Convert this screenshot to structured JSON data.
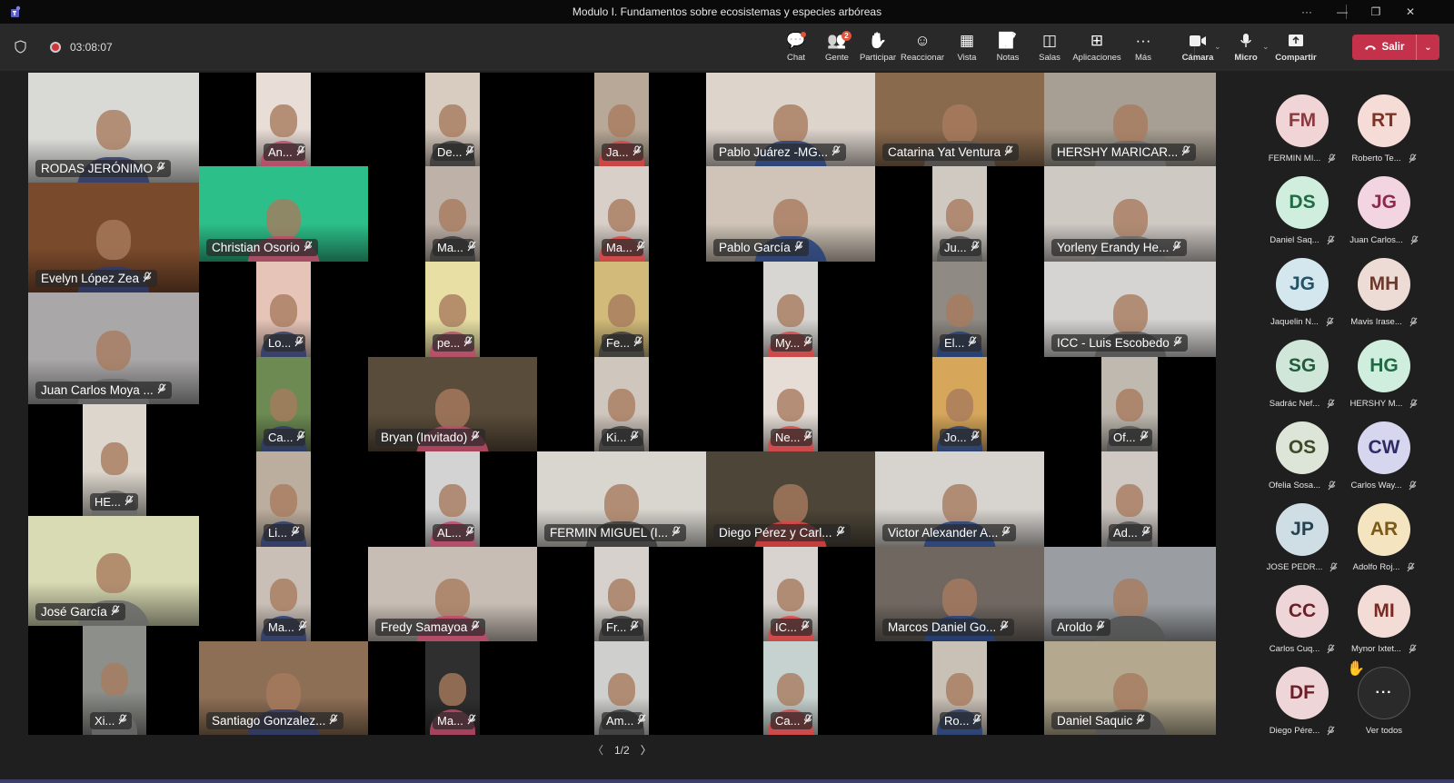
{
  "window": {
    "title": "Modulo I. Fundamentos sobre ecosistemas y especies arbóreas",
    "controls": {
      "more": "···",
      "minimize": "—",
      "restore": "❐",
      "close": "✕"
    }
  },
  "toolbar": {
    "timer": "03:08:07",
    "recording": true,
    "tools": [
      {
        "label": "Chat",
        "icon": "chat-icon",
        "glyph": "💬",
        "notification_dot": true
      },
      {
        "label": "Gente",
        "icon": "people-icon",
        "glyph": "👥",
        "badge": "2"
      },
      {
        "label": "Participar",
        "icon": "raise-hand-icon",
        "glyph": "✋"
      },
      {
        "label": "Reaccionar",
        "icon": "react-icon",
        "glyph": "☺"
      },
      {
        "label": "Vista",
        "icon": "view-grid-icon",
        "glyph": "▦"
      },
      {
        "label": "Notas",
        "icon": "notes-icon",
        "glyph": "📝"
      },
      {
        "label": "Salas",
        "icon": "rooms-icon",
        "glyph": "◫"
      },
      {
        "label": "Aplicaciones",
        "icon": "apps-icon",
        "glyph": "⊞"
      },
      {
        "label": "Más",
        "icon": "more-icon",
        "glyph": "···"
      }
    ],
    "camera_label": "Cámara",
    "mic_label": "Micro",
    "share_label": "Compartir",
    "leave_label": "Salir"
  },
  "video_tiles": [
    {
      "name": "RODAS JERÓNIMO",
      "bg": "#d9d9d6"
    },
    {
      "name": "An...",
      "bg": "#e9ddd7"
    },
    {
      "name": "De...",
      "bg": "#d8cbbf"
    },
    {
      "name": "Ja...",
      "bg": "#b8a897"
    },
    {
      "name": "Pablo Juárez -MG...",
      "bg": "#ddd4cc"
    },
    {
      "name": "Catarina Yat Ventura",
      "bg": "#8a6a4d"
    },
    {
      "name": "HERSHY MARICAR...",
      "bg": "#a79f93"
    },
    {
      "name": "Evelyn López Zea",
      "bg": "#7a4a2c"
    },
    {
      "name": "Christian Osorio",
      "bg": "#2dbf8a"
    },
    {
      "name": "Ma...",
      "bg": "#bdb1a8"
    },
    {
      "name": "Ma...",
      "bg": "#d8cfc8"
    },
    {
      "name": "Pablo García",
      "bg": "#cfc4b7"
    },
    {
      "name": "Ju...",
      "bg": "#cfc9c2"
    },
    {
      "name": "Yorleny Erandy He...",
      "bg": "#cfc9c4"
    },
    {
      "name": "Lo...",
      "bg": "#e6c5b8"
    },
    {
      "name": "pe...",
      "bg": "#e8dfa5"
    },
    {
      "name": "Fe...",
      "bg": "#d2bb7a"
    },
    {
      "name": "My...",
      "bg": "#d8d6d3"
    },
    {
      "name": "El...",
      "bg": "#8f8a84"
    },
    {
      "name": "ICC - Luis  Escobedo",
      "bg": "#d6d4d2"
    },
    {
      "name": "Juan Carlos Moya ...",
      "bg": "#a9a7a8"
    },
    {
      "name": "Ca...",
      "bg": "#6c8a52"
    },
    {
      "name": "Bryan  (Invitado)",
      "bg": "#5a4c3a"
    },
    {
      "name": "Ki...",
      "bg": "#cfc6bd"
    },
    {
      "name": "Ne...",
      "bg": "#e6ddd6"
    },
    {
      "name": "Jo...",
      "bg": "#d6a65a"
    },
    {
      "name": "Of...",
      "bg": "#bfb9b0"
    },
    {
      "name": "HE...",
      "bg": "#dcd6cd"
    },
    {
      "name": "Li...",
      "bg": "#bcae9f"
    },
    {
      "name": "AL...",
      "bg": "#d3d3d4"
    },
    {
      "name": "FERMIN MIGUEL (I...",
      "bg": "#d9d6d0"
    },
    {
      "name": "Diego Pérez y Carl...",
      "bg": "#4d4638"
    },
    {
      "name": "Victor Alexander A...",
      "bg": "#d7d3cf"
    },
    {
      "name": "Ad...",
      "bg": "#cfc8c3"
    },
    {
      "name": "José García",
      "bg": "#d9dbb4"
    },
    {
      "name": "Ma...",
      "bg": "#c9bfb6"
    },
    {
      "name": "Fredy Samayoa",
      "bg": "#c7bdb4"
    },
    {
      "name": "Fr...",
      "bg": "#d6d1cc"
    },
    {
      "name": "IC...",
      "bg": "#d8d3ce"
    },
    {
      "name": "Marcos Daniel Go...",
      "bg": "#6f6760"
    },
    {
      "name": "Aroldo",
      "bg": "#9a9ea2"
    },
    {
      "name": "Xi...",
      "bg": "#8d8f8a"
    },
    {
      "name": "Santiago Gonzalez...",
      "bg": "#8d6f55"
    },
    {
      "name": "Ma...",
      "bg": "#2f2f2f"
    },
    {
      "name": "Am...",
      "bg": "#cfd0cd"
    },
    {
      "name": "Ca...",
      "bg": "#c6d2cf"
    },
    {
      "name": "Ro...",
      "bg": "#c9c0b6"
    },
    {
      "name": "Daniel Saquic",
      "bg": "#b4a98f"
    }
  ],
  "sidebar_participants": [
    {
      "initials": "FM",
      "name": "FERMIN MI...",
      "bg": "#f1d4d6",
      "fg": "#8a3a3f"
    },
    {
      "initials": "RT",
      "name": "Roberto Te...",
      "bg": "#f5dcd6",
      "fg": "#7c3325"
    },
    {
      "initials": "DS",
      "name": "Daniel Saq...",
      "bg": "#cfeedd",
      "fg": "#1f6b45"
    },
    {
      "initials": "JG",
      "name": "Juan Carlos...",
      "bg": "#f2d5e0",
      "fg": "#8a2a4c"
    },
    {
      "initials": "JG",
      "name": "Jaquelin N...",
      "bg": "#d4e6ee",
      "fg": "#245266"
    },
    {
      "initials": "MH",
      "name": "Mavis Irase...",
      "bg": "#eddbd5",
      "fg": "#6b3a2c"
    },
    {
      "initials": "SG",
      "name": "Sadrác Nef...",
      "bg": "#cfe6d8",
      "fg": "#215c3c"
    },
    {
      "initials": "HG",
      "name": "HERSHY M...",
      "bg": "#cfeedd",
      "fg": "#1f6b45"
    },
    {
      "initials": "OS",
      "name": "Ofelia Sosa...",
      "bg": "#dde5d9",
      "fg": "#3c4a2a"
    },
    {
      "initials": "CW",
      "name": "Carlos Way...",
      "bg": "#d6d6ee",
      "fg": "#2e2c66"
    },
    {
      "initials": "JP",
      "name": "JOSE PEDR...",
      "bg": "#cfdee5",
      "fg": "#244453"
    },
    {
      "initials": "AR",
      "name": "Adolfo Roj...",
      "bg": "#f4e4c0",
      "fg": "#7a5a17"
    },
    {
      "initials": "CC",
      "name": "Carlos Cuq...",
      "bg": "#eed5d8",
      "fg": "#6b1f27"
    },
    {
      "initials": "MI",
      "name": "Mynor Ixtet...",
      "bg": "#f4dcd6",
      "fg": "#7a2a22"
    },
    {
      "initials": "DF",
      "name": "Diego Pére...",
      "bg": "#eed5d8",
      "fg": "#6b1f27"
    }
  ],
  "see_all": {
    "label": "Ver todos",
    "raised_hand": "✋"
  },
  "pagination": {
    "current": "1/2"
  },
  "colors": {
    "leave": "#c4314b",
    "recording": "#d13438",
    "badge": "#e1533a"
  }
}
